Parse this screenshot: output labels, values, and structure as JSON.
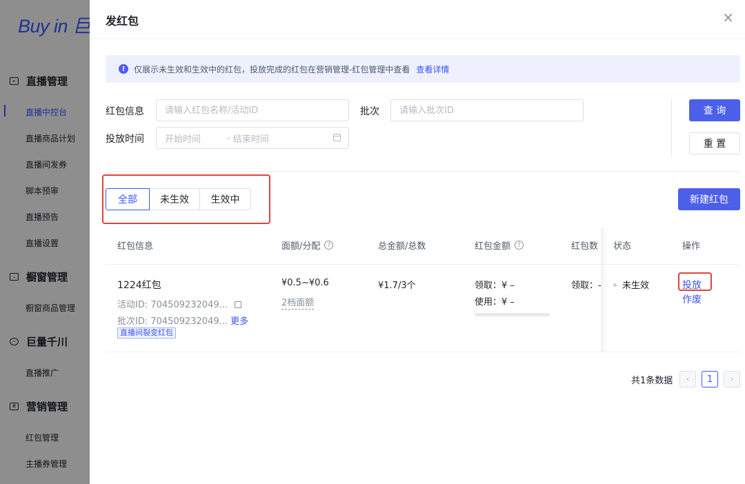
{
  "sidebar": {
    "brand": "Buy in 巨",
    "groups": [
      {
        "label": "直播管理",
        "items": [
          "直播中控台",
          "直播商品计划",
          "直播间发券",
          "脚本预审",
          "直播预告",
          "直播设置"
        ]
      },
      {
        "label": "橱窗管理",
        "items": [
          "橱窗商品管理"
        ]
      },
      {
        "label": "巨量千川",
        "items": [
          "直播推广"
        ]
      },
      {
        "label": "营销管理",
        "items": [
          "红包管理",
          "主播券管理"
        ]
      }
    ],
    "active_item": "直播中控台"
  },
  "drawer": {
    "title": "发红包",
    "close_glyph": "×"
  },
  "notice": {
    "text": "仅展示未生效和生效中的红包，投放完成的红包在营销管理-红包管理中查看",
    "link": "查看详情",
    "icon_glyph": "!"
  },
  "filters": {
    "redpack_label": "红包信息",
    "redpack_placeholder": "请输入红包名称/活动ID",
    "batch_label": "批次",
    "batch_placeholder": "请输入批次ID",
    "time_label": "投放时间",
    "start_placeholder": "开始时间",
    "range_sep": "-",
    "end_placeholder": "结束时间",
    "query_button": "查 询",
    "reset_button": "重 置"
  },
  "tabs": [
    "全部",
    "未生效",
    "生效中"
  ],
  "active_tab": "全部",
  "new_button": "新建红包",
  "table": {
    "columns": [
      "红包信息",
      "面额/分配",
      "总金额/总数",
      "红包金额",
      "红包数",
      "状态",
      "操作"
    ],
    "rows": [
      {
        "name": "1224红包",
        "activity_id": "活动ID: 704509232049...",
        "batch_id": "批次ID: 704509232049...",
        "more": "更多",
        "tag": "直播间裂变红包",
        "denomination": "¥0.5~¥0.6",
        "tiers": "2档面额",
        "total": "¥1.7/3个",
        "received": "领取：¥ –",
        "used": "使用：¥ –",
        "progress": 0,
        "count_received": "领取：-",
        "status": "未生效",
        "actions": [
          "投放",
          "作废"
        ]
      }
    ]
  },
  "pagination": {
    "total_text": "共1条数据",
    "prev": "‹",
    "next": "›",
    "current": "1"
  },
  "colors": {
    "accent": "#3955f6",
    "primary_button": "#4c5fe9",
    "highlight_box": "#e0423d"
  }
}
